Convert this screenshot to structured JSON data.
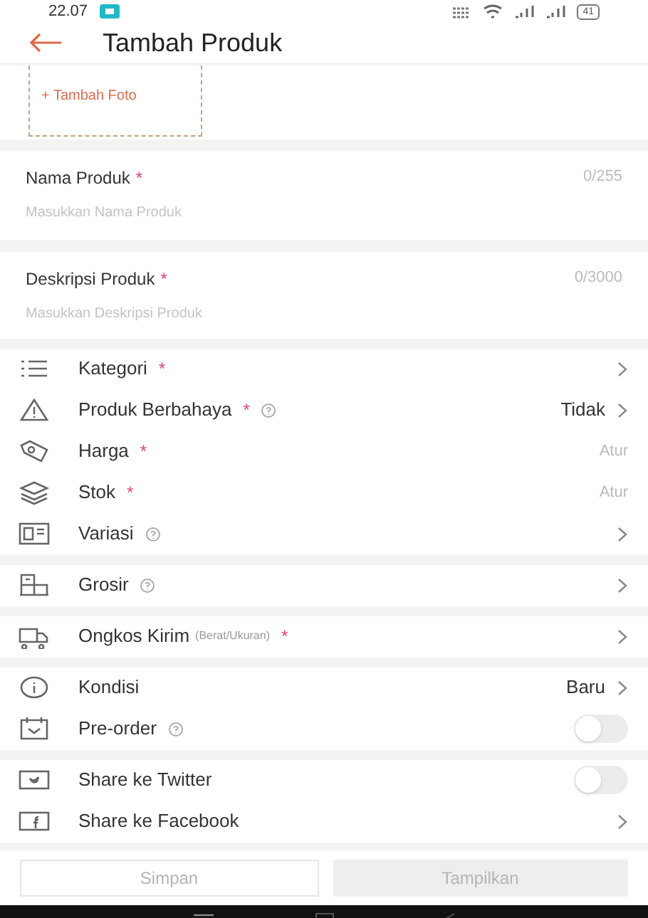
{
  "status_bar": {
    "time": "22.07",
    "battery": "41"
  },
  "header": {
    "title": "Tambah Produk"
  },
  "photo": {
    "label": "+ Tambah Foto"
  },
  "fields": [
    {
      "label": "Nama Produk",
      "required_mark": "*",
      "counter": "0/255",
      "placeholder": "Masukkan Nama Produk"
    },
    {
      "label": "Deskripsi Produk",
      "required_mark": "*",
      "counter": "0/3000",
      "placeholder": "Masukkan Deskripsi Produk"
    }
  ],
  "sections": [
    {
      "rows": [
        {
          "label": "Kategori",
          "required_mark": "*",
          "help": false,
          "kind": "nav"
        },
        {
          "label": "Produk Berbahaya",
          "required_mark": "*",
          "help": true,
          "kind": "value",
          "value": "Tidak"
        },
        {
          "label": "Harga",
          "required_mark": "*",
          "help": false,
          "kind": "setting",
          "value": "Atur"
        },
        {
          "label": "Stok",
          "required_mark": "*",
          "help": false,
          "kind": "setting",
          "value": "Atur"
        },
        {
          "label": "Variasi",
          "help": true,
          "kind": "nav"
        }
      ]
    },
    {
      "rows": [
        {
          "label": "Grosir",
          "help": true,
          "kind": "nav"
        }
      ]
    },
    {
      "rows": [
        {
          "label": "Ongkos Kirim",
          "sublabel": "(Berat/Ukuran)",
          "required_mark": "*",
          "help": false,
          "kind": "nav"
        }
      ]
    },
    {
      "rows": [
        {
          "label": "Kondisi",
          "help": false,
          "kind": "value",
          "value": "Baru"
        },
        {
          "label": "Pre-order",
          "help": true,
          "kind": "toggle",
          "on": false
        }
      ]
    },
    {
      "rows": [
        {
          "label": "Share ke Twitter",
          "help": false,
          "kind": "toggle",
          "on": false
        },
        {
          "label": "Share ke Facebook",
          "help": false,
          "kind": "nav"
        }
      ]
    }
  ],
  "buttons": [
    {
      "label": "Simpan",
      "kind": "outline"
    },
    {
      "label": "Tampilkan",
      "kind": "filled"
    }
  ]
}
